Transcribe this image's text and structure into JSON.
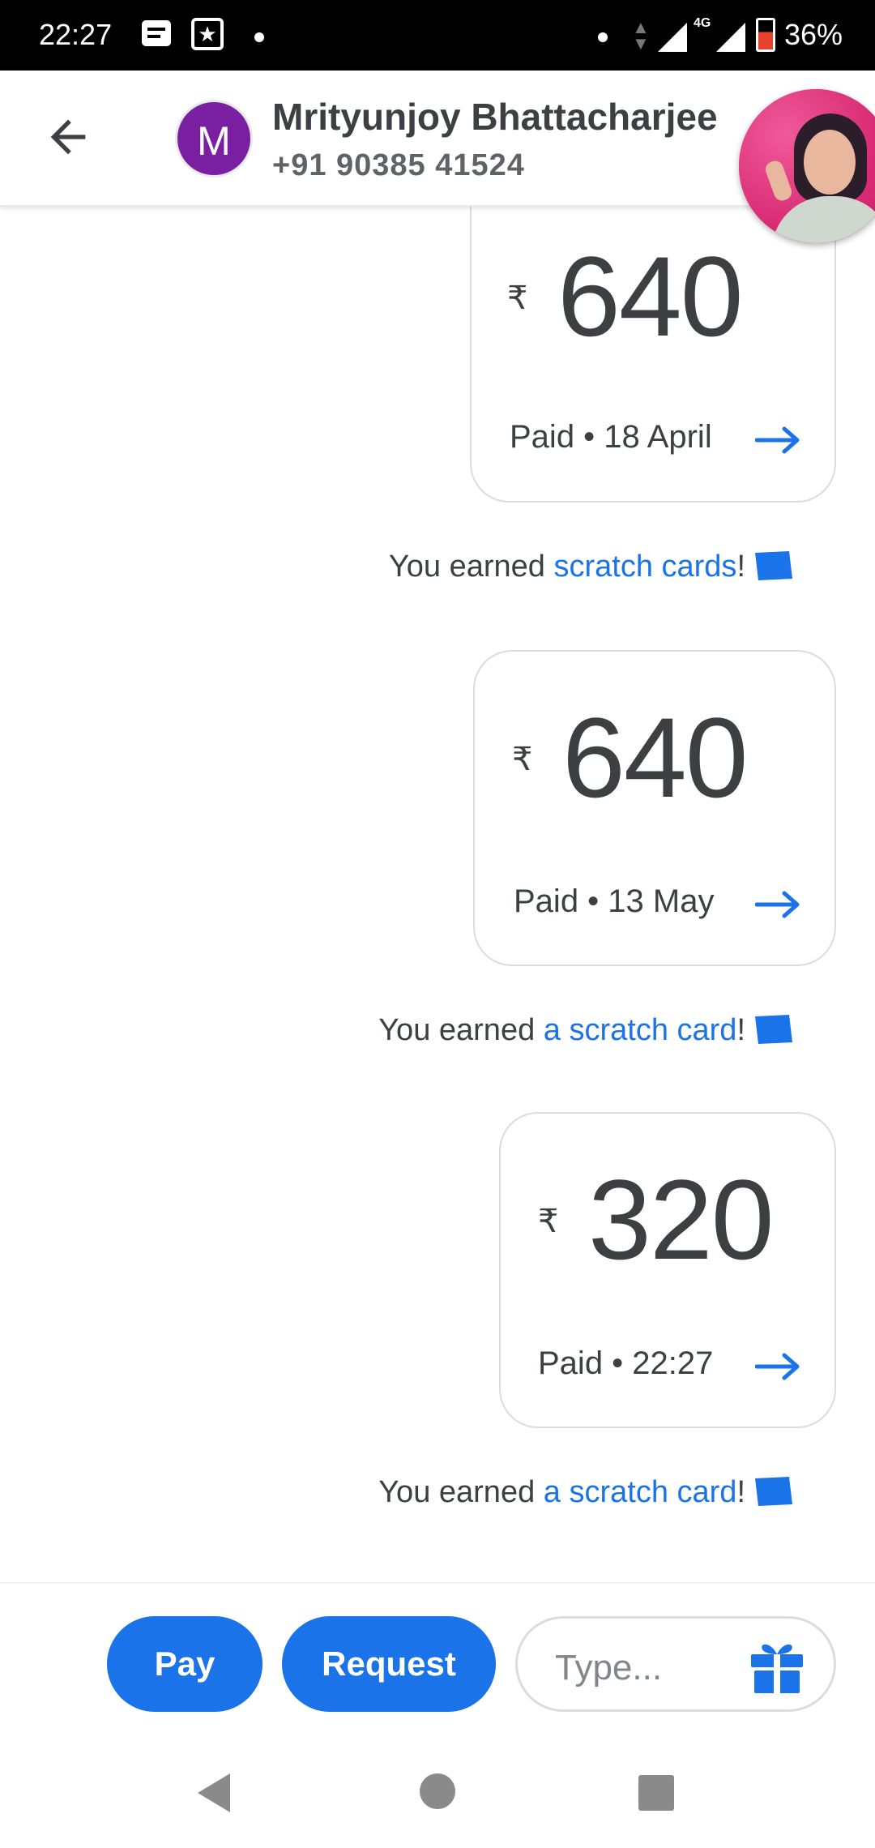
{
  "status_bar": {
    "time": "22:27",
    "network": "4G",
    "battery_percent": "36%",
    "icons": [
      "message-icon",
      "star-app-icon",
      "notification-dot",
      "data-arrows-icon",
      "signal-icon",
      "signal-4g-icon",
      "battery-icon"
    ]
  },
  "header": {
    "avatar_letter": "M",
    "name": "Mrityunjoy Bhattacharjee",
    "phone": "+91 90385 41524"
  },
  "transactions": [
    {
      "currency": "₹",
      "amount": "640",
      "status": "Paid • 18 April"
    },
    {
      "currency": "₹",
      "amount": "640",
      "status": "Paid • 13 May"
    },
    {
      "currency": "₹",
      "amount": "320",
      "status": "Paid • 22:27"
    }
  ],
  "scratch_messages": [
    {
      "prefix": "You earned ",
      "link": "scratch cards",
      "suffix": "!"
    },
    {
      "prefix": "You earned ",
      "link": "a scratch card",
      "suffix": "!"
    },
    {
      "prefix": "You earned ",
      "link": "a scratch card",
      "suffix": "!"
    }
  ],
  "actions": {
    "pay_label": "Pay",
    "request_label": "Request",
    "type_placeholder": "Type..."
  },
  "colors": {
    "accent": "#1a73e8",
    "avatar_bg": "#7b1fa2",
    "text": "#3c4043"
  }
}
